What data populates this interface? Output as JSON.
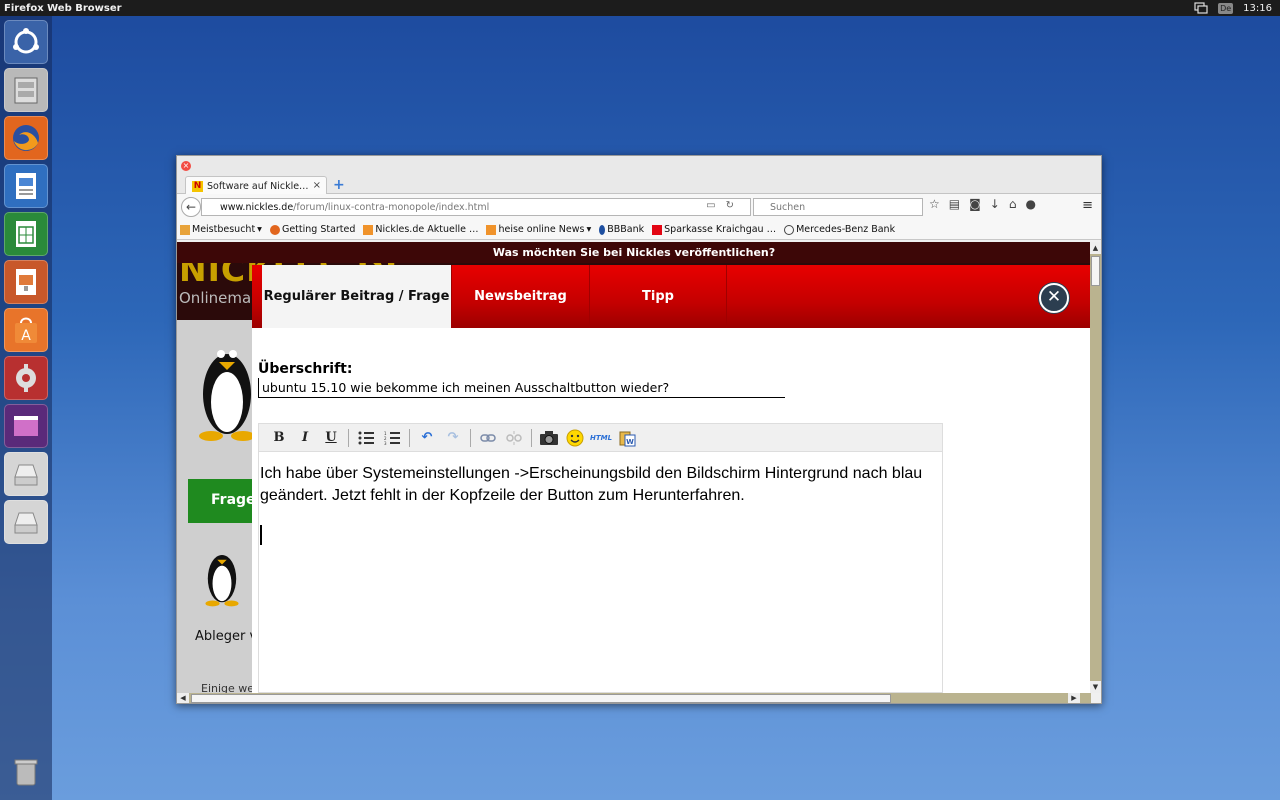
{
  "top_panel": {
    "title": "Firefox Web Browser",
    "keyboard": "De",
    "clock": "13:16"
  },
  "launcher": {
    "items": [
      "ubuntu-dash-icon",
      "files-icon",
      "firefox-icon",
      "writer-icon",
      "calc-icon",
      "impress-icon",
      "software-center-icon",
      "system-settings-icon",
      "workspace-switcher-icon",
      "drive-icon",
      "drive-icon",
      "trash-icon"
    ]
  },
  "browser": {
    "tab_title": "Software auf Nickle…",
    "url_host": "www.nickles.de",
    "url_path": "/forum/linux-contra-monopole/index.html",
    "search_placeholder": "Suchen",
    "bookmarks": [
      "Meistbesucht",
      "Getting Started",
      "Nickles.de Aktuelle …",
      "heise online News",
      "BBBank",
      "Sparkasse Kraichgau …",
      "Mercedes-Benz Bank"
    ]
  },
  "site": {
    "header_strip": "Was möchten Sie bei Nickles veröffentlichen?",
    "logo": "NICKLES.DE",
    "tagline": "Onlinema",
    "frage_button": "Frage",
    "ablegen": "Ableger v",
    "einige": "Einige we"
  },
  "modal": {
    "tabs": [
      "Regulärer Beitrag / Frage",
      "Newsbeitrag",
      "Tipp"
    ],
    "close_icon": "close-icon",
    "heading_label": "Überschrift:",
    "heading_value": "ubuntu 15.10 wie bekomme ich meinen Ausschaltbutton wieder?",
    "body_text": "Ich habe über Systemeinstellungen ->Erscheinungsbild den Bildschirm Hintergrund nach blau geändert. Jetzt fehlt in der Kopfzeile der Button zum Herunterfahren.",
    "toolbar": {
      "bold": "B",
      "italic": "I",
      "underline": "U",
      "html": "HTML"
    }
  },
  "colors": {
    "accent_red": "#e80000",
    "desktop_blue": "#2d67b8"
  }
}
